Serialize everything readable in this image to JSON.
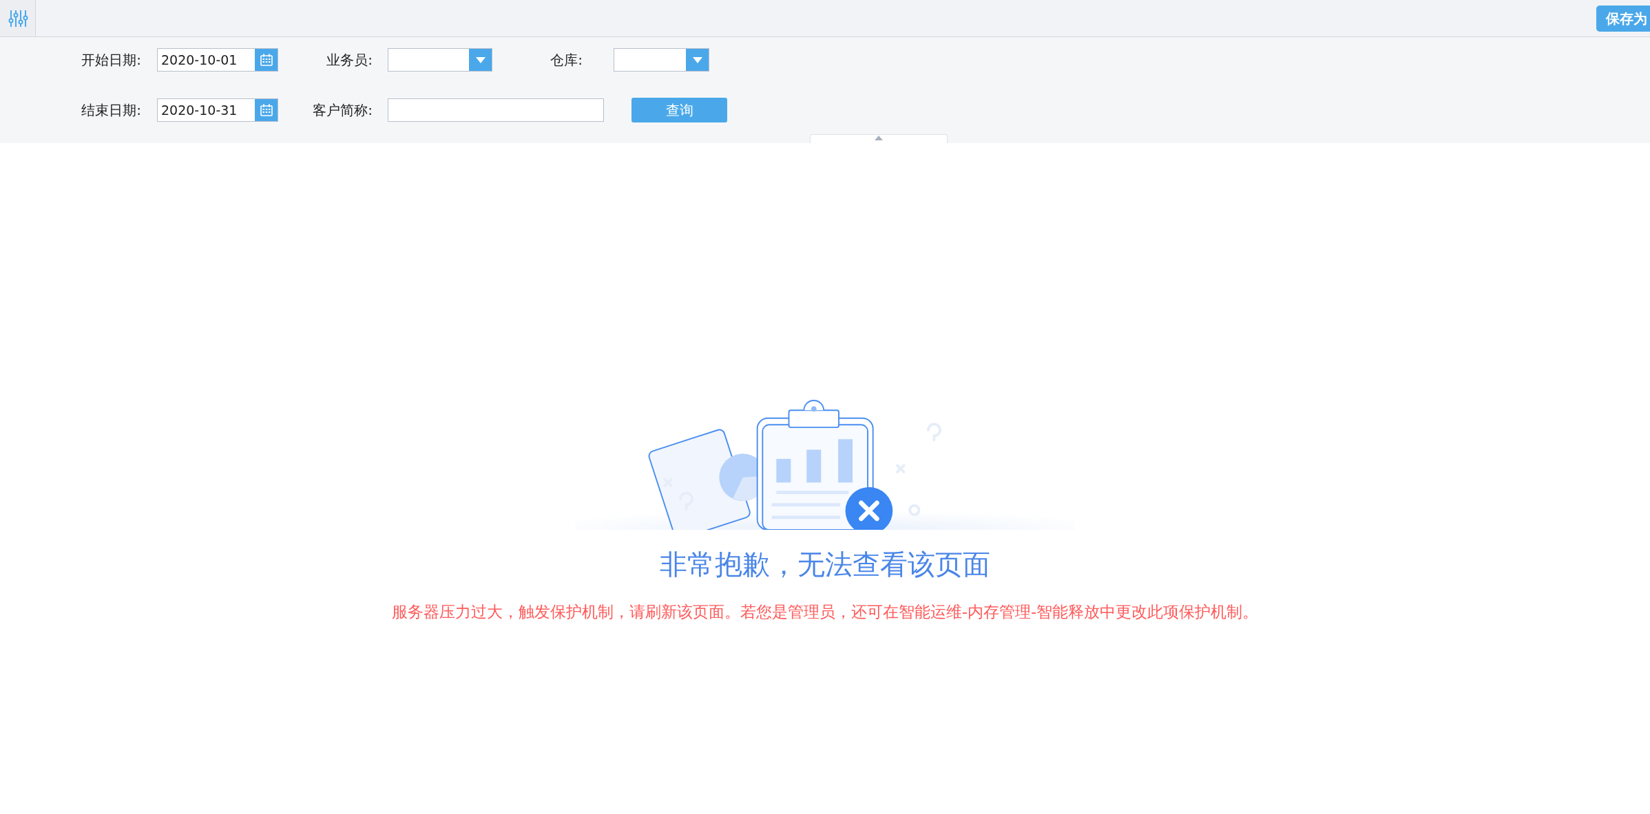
{
  "toolbar": {
    "save_button": "保存为"
  },
  "filter_rows": [
    [
      {
        "kind": "date",
        "label": "开始日期:",
        "value": "2020-10-01"
      },
      {
        "kind": "select",
        "label": "业务员:"
      },
      {
        "kind": "select",
        "label": "仓库:"
      }
    ],
    [
      {
        "kind": "date",
        "label": "结束日期:",
        "value": "2020-10-31"
      },
      {
        "kind": "text",
        "label": "客户简称:"
      },
      {
        "kind": "button",
        "label": "查询"
      }
    ]
  ],
  "error": {
    "title": "非常抱歉，无法查看该页面",
    "message": "服务器压力过大，触发保护机制，请刷新该页面。若您是管理员，还可在智能运维-内存管理-智能释放中更改此项保护机制。"
  }
}
